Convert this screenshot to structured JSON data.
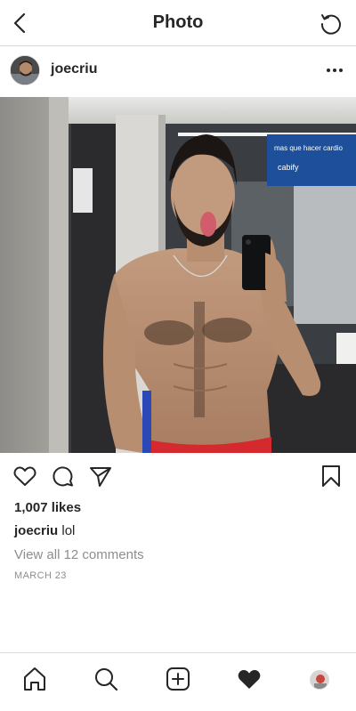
{
  "top_bar": {
    "title": "Photo",
    "back_icon": "chevron-left-icon",
    "refresh_icon": "refresh-icon"
  },
  "post": {
    "username": "joecriu",
    "more_icon": "more-horizontal-icon",
    "likes": "1,007 likes",
    "caption_user": "joecriu",
    "caption_text": "lol",
    "comments_link": "View all 12 comments",
    "date": "MARCH 23"
  },
  "actions": {
    "like_icon": "heart-outline-icon",
    "comment_icon": "comment-icon",
    "share_icon": "send-icon",
    "save_icon": "bookmark-icon"
  },
  "tab_bar": {
    "items": [
      "home-icon",
      "search-icon",
      "new-post-icon",
      "activity-heart-icon",
      "profile-avatar"
    ]
  },
  "colors": {
    "text": "#262626",
    "muted": "#8e8e8e",
    "divider": "#dbdbdb",
    "sign_blue": "#1e4f9a",
    "shorts_red": "#d42a2f"
  }
}
